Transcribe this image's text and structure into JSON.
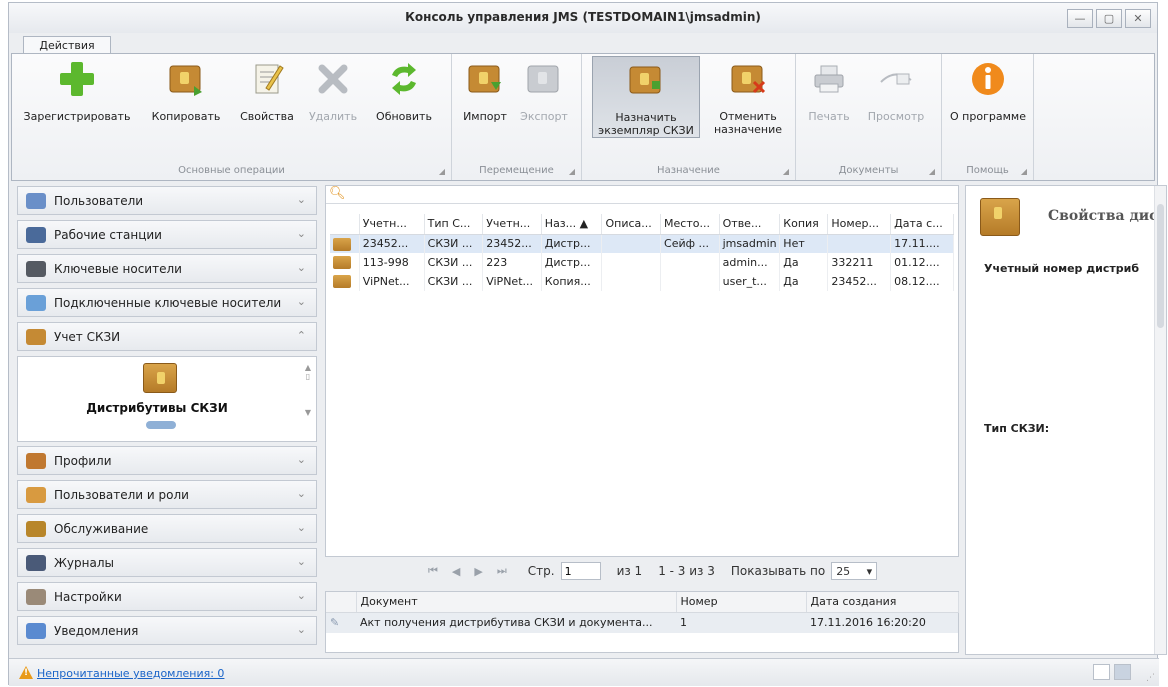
{
  "window": {
    "title": "Консоль управления JMS (TESTDOMAIN1\\jmsadmin)"
  },
  "ribbon_tab": "Действия",
  "ribbon": {
    "groups": [
      {
        "caption": "Основные операции"
      },
      {
        "caption": "Перемещение"
      },
      {
        "caption": "Назначение"
      },
      {
        "caption": "Документы"
      },
      {
        "caption": "Помощь"
      }
    ],
    "buttons": {
      "register": "Зарегистрировать",
      "copy": "Копировать",
      "properties": "Свойства",
      "delete": "Удалить",
      "refresh": "Обновить",
      "import": "Импорт",
      "export": "Экспорт",
      "assign_line1": "Назначить",
      "assign_line2": "экземпляр СКЗИ",
      "unassign_line1": "Отменить",
      "unassign_line2": "назначение",
      "print": "Печать",
      "preview": "Просмотр",
      "about": "О программе"
    }
  },
  "nav": {
    "items": [
      {
        "label": "Пользователи"
      },
      {
        "label": "Рабочие станции"
      },
      {
        "label": "Ключевые носители"
      },
      {
        "label": "Подключенные ключевые носители"
      },
      {
        "label": "Учет СКЗИ"
      },
      {
        "label": "Профили"
      },
      {
        "label": "Пользователи и роли"
      },
      {
        "label": "Обслуживание"
      },
      {
        "label": "Журналы"
      },
      {
        "label": "Настройки"
      },
      {
        "label": "Уведомления"
      }
    ],
    "expanded_item": "Дистрибутивы СКЗИ"
  },
  "grid": {
    "columns": [
      "Учетн...",
      "Тип С...",
      "Учетн...",
      "Наз... ▲",
      "Описа...",
      "Место...",
      "Отве...",
      "Копия",
      "Номер...",
      "Дата с..."
    ],
    "rows": [
      {
        "c0": "23452...",
        "c1": "СКЗИ ...",
        "c2": "23452...",
        "c3": "Дистр...",
        "c4": "",
        "c5": "Сейф ...",
        "c6": "jmsadmin",
        "c7": "Нет",
        "c8": "",
        "c9": "17.11...."
      },
      {
        "c0": "113-998",
        "c1": "СКЗИ ...",
        "c2": "223",
        "c3": "Дистр...",
        "c4": "",
        "c5": "",
        "c6": "admin...",
        "c7": "Да",
        "c8": "332211",
        "c9": "01.12...."
      },
      {
        "c0": "ViPNet...",
        "c1": "СКЗИ ...",
        "c2": "ViPNet...",
        "c3": "Копия...",
        "c4": "",
        "c5": "",
        "c6": "user_t...",
        "c7": "Да",
        "c8": "23452...",
        "c9": "08.12...."
      }
    ]
  },
  "pager": {
    "page_label": "Стр.",
    "page_value": "1",
    "of_label": "из 1",
    "range": "1 - 3 из 3",
    "show_label": "Показывать по",
    "page_size": "25"
  },
  "docs": {
    "columns": [
      "Документ",
      "Номер",
      "Дата создания"
    ],
    "row": {
      "doc": "Акт получения дистрибутива СКЗИ и документа...",
      "num": "1",
      "date": "17.11.2016 16:20:20"
    }
  },
  "props": {
    "title": "Свойства дис",
    "field1": "Учетный номер дистриб",
    "field2": "Тип СКЗИ:"
  },
  "status": {
    "link": "Непрочитанные уведомления: 0"
  },
  "colors": {
    "accent_box": "#c58a34",
    "link": "#1a64c8",
    "warning": "#e89a1a",
    "selection": "#dde8f6"
  }
}
